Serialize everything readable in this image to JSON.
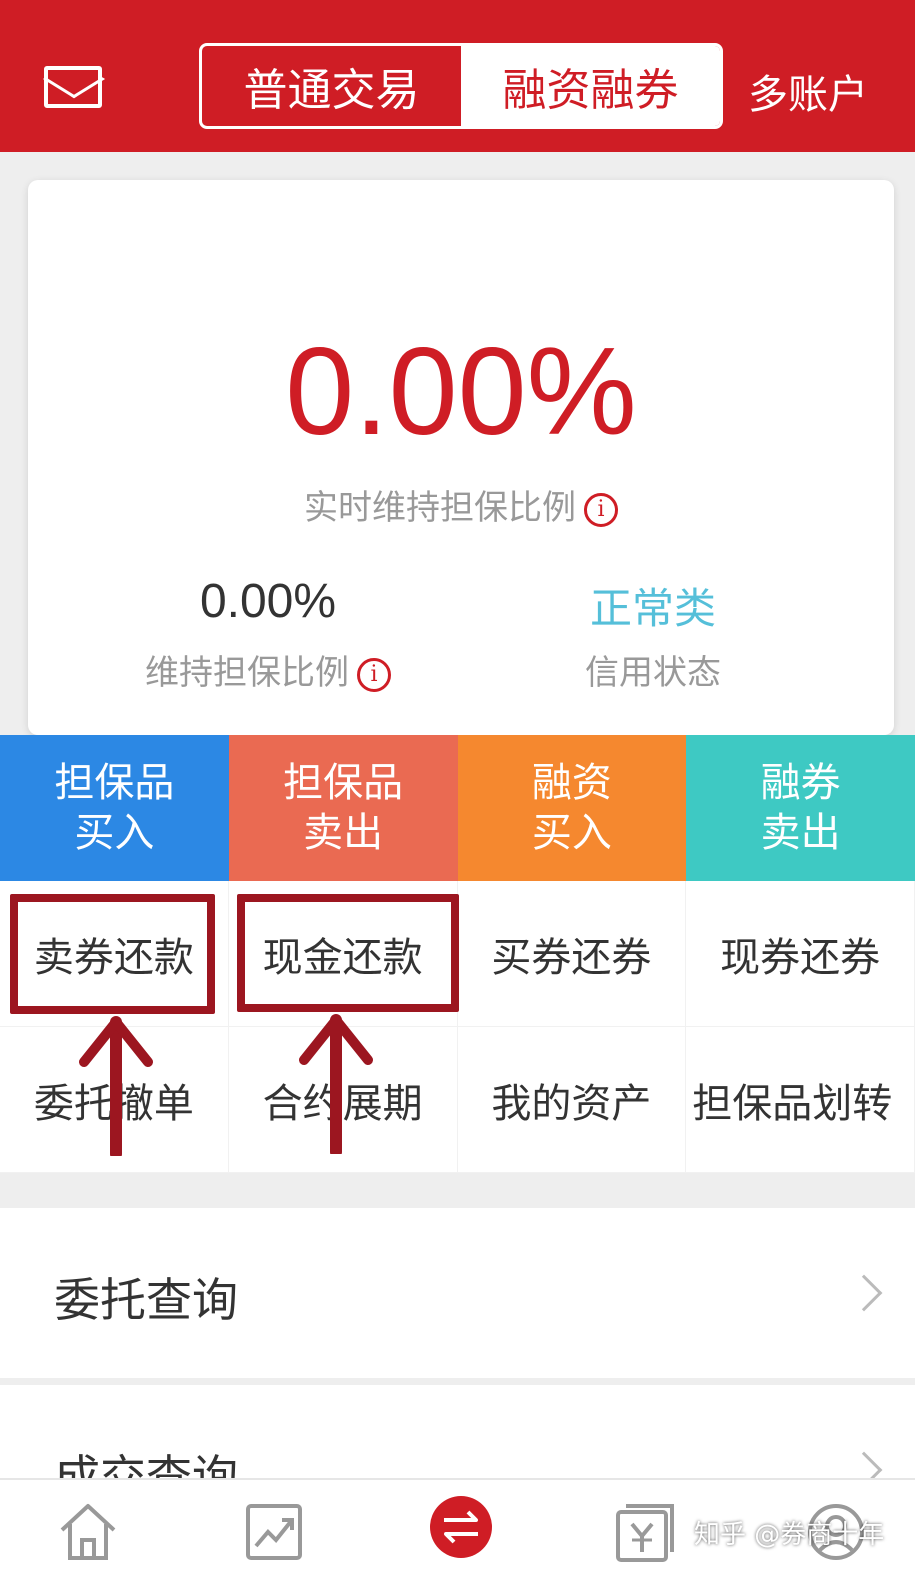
{
  "header": {
    "segments": [
      "普通交易",
      "融资融券"
    ],
    "active_segment": "融资融券",
    "multi_account": "多账户",
    "brand_color": "#cf1d25"
  },
  "summary": {
    "realtime_ratio": "0.00%",
    "realtime_ratio_label": "实时维持担保比例",
    "maintenance_ratio": "0.00%",
    "maintenance_ratio_label": "维持担保比例",
    "credit_status": "正常类",
    "credit_status_label": "信用状态",
    "info_icon_glyph": "i"
  },
  "quick_actions": [
    {
      "line1": "担保品",
      "line2": "买入",
      "color": "#2c88e4"
    },
    {
      "line1": "担保品",
      "line2": "卖出",
      "color": "#ea6a52"
    },
    {
      "line1": "融资",
      "line2": "买入",
      "color": "#f5882f"
    },
    {
      "line1": "融券",
      "line2": "卖出",
      "color": "#3ec9c3"
    }
  ],
  "functions": [
    "卖券还款",
    "现金还款",
    "买券还券",
    "现券还券",
    "委托撤单",
    "合约展期",
    "我的资产",
    "担保品划转"
  ],
  "highlighted_functions": [
    "卖券还款",
    "现金还款"
  ],
  "annotation_color": "#9c1620",
  "list": [
    "委托查询",
    "成交查询"
  ],
  "tabbar": {
    "icons": [
      "home-icon",
      "chart-icon",
      "transfer-icon",
      "yen-bill-icon",
      "profile-icon"
    ],
    "active_color": "#cf1d25"
  },
  "watermark": "知乎 @券商十年"
}
